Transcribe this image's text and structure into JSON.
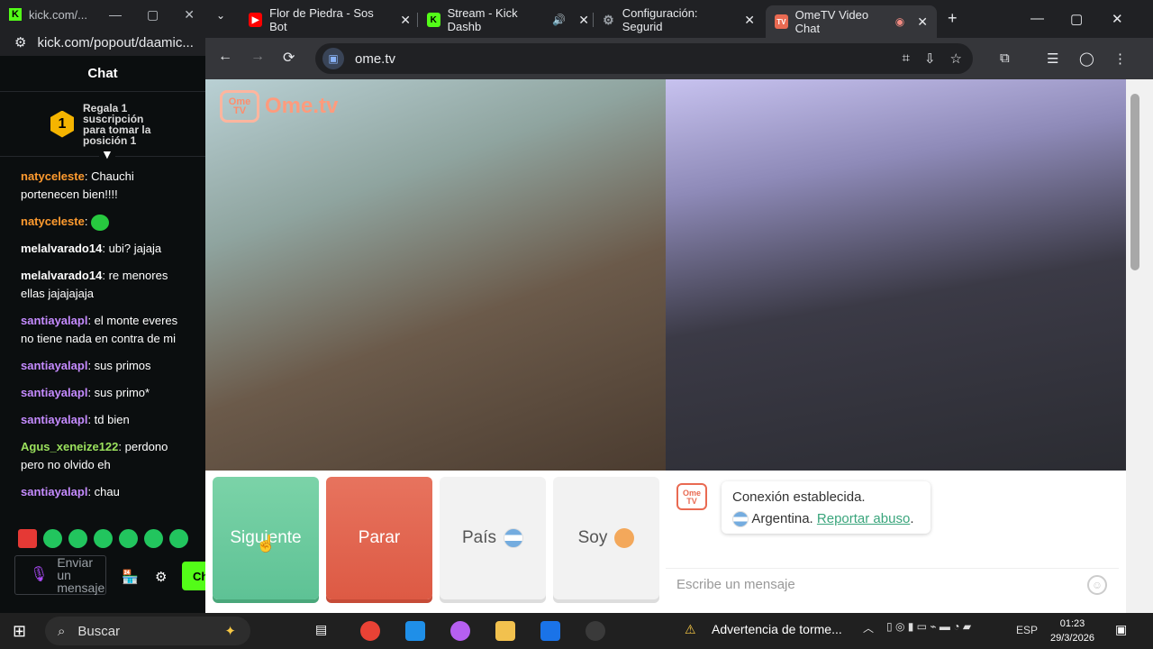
{
  "kick_window": {
    "tab_title": "kick.com/...",
    "url": "kick.com/popout/daamic...",
    "chat_title": "Chat",
    "promo_rank": "1",
    "promo_text": "Regala 1 suscripción para tomar la posición 1",
    "messages": [
      {
        "user": "natyceleste",
        "color": "#ff9b2f",
        "text": "Chauchi portenecen bien!!!!"
      },
      {
        "user": "natyceleste",
        "color": "#ff9b2f",
        "text": ""
      },
      {
        "user": "melalvarado14",
        "color": "#ffffff",
        "text": "ubi? jajaja"
      },
      {
        "user": "melalvarado14",
        "color": "#ffffff",
        "text": "re menores ellas jajajajaja"
      },
      {
        "user": "santiayalapl",
        "color": "#c58bff",
        "text": "el monte everes no tiene nada en contra de mi"
      },
      {
        "user": "santiayalapl",
        "color": "#c58bff",
        "text": "sus primos"
      },
      {
        "user": "santiayalapl",
        "color": "#c58bff",
        "text": "sus primo*"
      },
      {
        "user": "santiayalapl",
        "color": "#c58bff",
        "text": "td bien"
      },
      {
        "user": "Agus_xeneize122",
        "color": "#9be15d",
        "text": "perdono pero no olvido eh"
      },
      {
        "user": "santiayalapl",
        "color": "#c58bff",
        "text": "chau"
      }
    ],
    "composer_placeholder": "Enviar un mensaje",
    "send_label": "Ch"
  },
  "browser": {
    "tabs": [
      {
        "title": "Flor de Piedra - Sos Bot",
        "icon": "youtube-icon",
        "color": "#ff0000"
      },
      {
        "title": "Stream - Kick Dashb",
        "icon": "kick-icon",
        "color": "#53fc18"
      },
      {
        "title": "Configuración: Segurid",
        "icon": "gear-icon",
        "color": "#9aa0a6"
      },
      {
        "title": "OmeTV Video Chat",
        "icon": "ometv-icon",
        "color": "#e96a52",
        "active": true
      }
    ],
    "url": "ome.tv"
  },
  "ometv": {
    "logo_tv": "Ome TV",
    "logo_text": "Ome.tv",
    "buttons": {
      "next": "Siguiente",
      "stop": "Parar",
      "country": "País",
      "me": "Soy"
    },
    "bot_icon": "Ome TV",
    "status_line1": "Conexión establecida.",
    "status_country": "Argentina.",
    "report_link": "Reportar abuso",
    "message_placeholder": "Escribe un mensaje"
  },
  "taskbar": {
    "search": "Buscar",
    "weather_alert": "Advertencia de torme...",
    "lang": "ESP",
    "time": "01:23",
    "date": "29/3/2026"
  }
}
